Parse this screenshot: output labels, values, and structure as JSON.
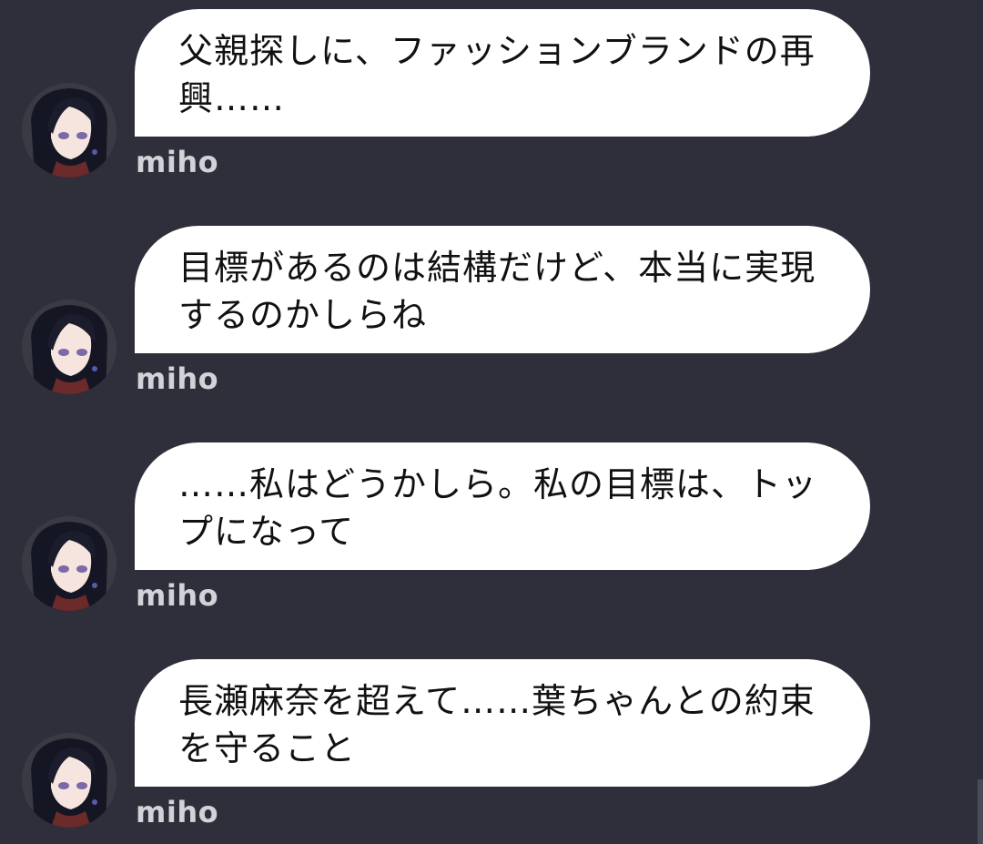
{
  "chat": {
    "messages": [
      {
        "sender": "miho",
        "avatar_icon": "miho-avatar-icon",
        "text": "父親探しに、ファッションブランドの再興……"
      },
      {
        "sender": "miho",
        "avatar_icon": "miho-avatar-icon",
        "text": "目標があるのは結構だけど、本当に実現するのかしらね"
      },
      {
        "sender": "miho",
        "avatar_icon": "miho-avatar-icon",
        "text": "……私はどうかしら。私の目標は、トップになって"
      },
      {
        "sender": "miho",
        "avatar_icon": "miho-avatar-icon",
        "text": "長瀬麻奈を超えて……葉ちゃんとの約束を守ること"
      }
    ]
  },
  "colors": {
    "background": "#2e2f3b",
    "bubble": "#ffffff",
    "bubble_text": "#111111",
    "username": "#d2d2d8"
  }
}
